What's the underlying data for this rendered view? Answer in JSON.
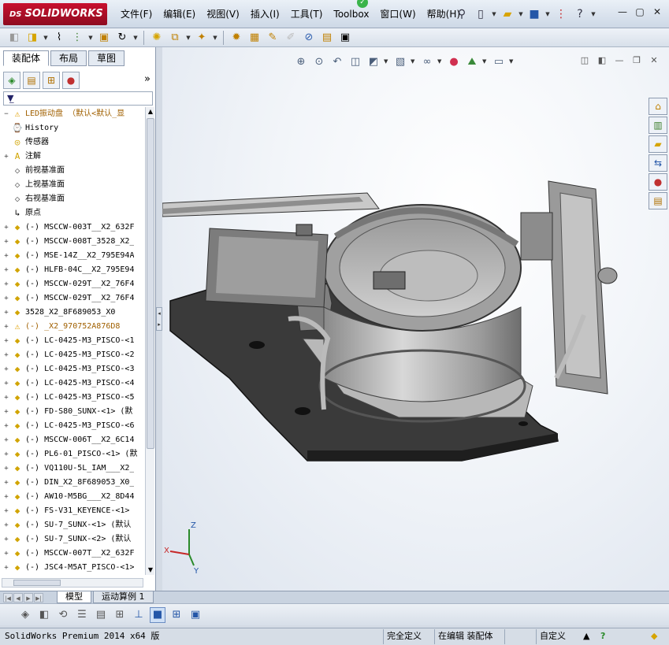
{
  "app": {
    "name": "SOLIDWORKS",
    "logo_prefix": "DS"
  },
  "menu": [
    "文件(F)",
    "编辑(E)",
    "视图(V)",
    "插入(I)",
    "工具(T)",
    "Toolbox",
    "窗口(W)",
    "帮助(H)"
  ],
  "title_tools": [
    "new-document-icon",
    "open-icon",
    "save-icon",
    "traffic-light-icon",
    "help-icon"
  ],
  "window_controls": {
    "minimize": "—",
    "restore": "▢",
    "close": "✕"
  },
  "toolbar_icons": [
    "assembly-icon",
    "insert-components-icon",
    "mate-icon",
    "smart-fastener-icon",
    "move-component-icon",
    "rotate-component-icon",
    "linear-pattern-icon",
    "smart-mates-icon",
    "explode-icon",
    "interference-icon",
    "hide-show-icon",
    "edit-component-icon",
    "assembly-features-icon",
    "reference-geometry-icon",
    "bill-of-materials-icon",
    "exploded-view-icon"
  ],
  "left_panel": {
    "tabs": [
      "装配体",
      "布局",
      "草图"
    ],
    "active_tab": 0,
    "icon_row": [
      "featuremanager-icon",
      "propertymanager-icon",
      "configurationmanager-icon",
      "appearance-icon"
    ],
    "more": "»",
    "filter_icon": "filter-icon"
  },
  "tree": [
    {
      "text": "LED振动盘 （默认<默认_显",
      "icon": "assembly-warning",
      "expand": "−",
      "color": "#a06000"
    },
    {
      "text": "History",
      "icon": "history",
      "expand": "",
      "color": "#000"
    },
    {
      "text": "传感器",
      "icon": "sensor",
      "expand": "",
      "color": "#000"
    },
    {
      "text": "注解",
      "icon": "annotation",
      "expand": "+",
      "color": "#000"
    },
    {
      "text": "前视基准面",
      "icon": "plane",
      "expand": "",
      "color": "#000"
    },
    {
      "text": "上视基准面",
      "icon": "plane",
      "expand": "",
      "color": "#000"
    },
    {
      "text": "右视基准面",
      "icon": "plane",
      "expand": "",
      "color": "#000"
    },
    {
      "text": "原点",
      "icon": "origin",
      "expand": "",
      "color": "#000"
    },
    {
      "text": "(-) MSCCW-003T__X2_632F",
      "icon": "part",
      "expand": "+",
      "color": "#000"
    },
    {
      "text": "(-) MSCCW-008T_3528_X2_",
      "icon": "part",
      "expand": "+",
      "color": "#000"
    },
    {
      "text": "(-) MSE-14Z__X2_795E94A",
      "icon": "part",
      "expand": "+",
      "color": "#000"
    },
    {
      "text": "(-) HLFB-04C__X2_795E94",
      "icon": "part",
      "expand": "+",
      "color": "#000"
    },
    {
      "text": "(-) MSCCW-029T__X2_76F4",
      "icon": "part",
      "expand": "+",
      "color": "#000"
    },
    {
      "text": "(-) MSCCW-029T__X2_76F4",
      "icon": "part",
      "expand": "+",
      "color": "#000"
    },
    {
      "text": "3528_X2_8F689053_X0",
      "icon": "part",
      "expand": "+",
      "color": "#000"
    },
    {
      "text": "(-) _X2_970752A876D8",
      "icon": "part-warning",
      "expand": "+",
      "color": "#a06000"
    },
    {
      "text": "(-) LC-0425-M3_PISCO-<1",
      "icon": "part",
      "expand": "+",
      "color": "#000"
    },
    {
      "text": "(-) LC-0425-M3_PISCO-<2",
      "icon": "part",
      "expand": "+",
      "color": "#000"
    },
    {
      "text": "(-) LC-0425-M3_PISCO-<3",
      "icon": "part",
      "expand": "+",
      "color": "#000"
    },
    {
      "text": "(-) LC-0425-M3_PISCO-<4",
      "icon": "part",
      "expand": "+",
      "color": "#000"
    },
    {
      "text": "(-) LC-0425-M3_PISCO-<5",
      "icon": "part",
      "expand": "+",
      "color": "#000"
    },
    {
      "text": "(-) FD-S80_SUNX-<1> (默",
      "icon": "part",
      "expand": "+",
      "color": "#000"
    },
    {
      "text": "(-) LC-0425-M3_PISCO-<6",
      "icon": "part",
      "expand": "+",
      "color": "#000"
    },
    {
      "text": "(-) MSCCW-006T__X2_6C14",
      "icon": "part",
      "expand": "+",
      "color": "#000"
    },
    {
      "text": "(-) PL6-01_PISCO-<1> (默",
      "icon": "part",
      "expand": "+",
      "color": "#000"
    },
    {
      "text": "(-) VQ110U-5L_IAM___X2_",
      "icon": "part",
      "expand": "+",
      "color": "#000"
    },
    {
      "text": "(-) DIN_X2_8F689053_X0_",
      "icon": "part",
      "expand": "+",
      "color": "#000"
    },
    {
      "text": "(-) AW10-M5BG___X2_8D44",
      "icon": "part",
      "expand": "+",
      "color": "#000"
    },
    {
      "text": "(-) FS-V31_KEYENCE-<1>",
      "icon": "part",
      "expand": "+",
      "color": "#000"
    },
    {
      "text": "(-) SU-7_SUNX-<1> (默认",
      "icon": "part",
      "expand": "+",
      "color": "#000"
    },
    {
      "text": "(-) SU-7_SUNX-<2> (默认",
      "icon": "part",
      "expand": "+",
      "color": "#000"
    },
    {
      "text": "(-) MSCCW-007T__X2_632F",
      "icon": "part",
      "expand": "+",
      "color": "#000"
    },
    {
      "text": "(-) JSC4-M5AT_PISCO-<1>",
      "icon": "part",
      "expand": "+",
      "color": "#000"
    }
  ],
  "viewport": {
    "heads_up_icons": [
      "zoom-to-fit-icon",
      "zoom-area-icon",
      "previous-view-icon",
      "section-view-icon",
      "view-orientation-icon",
      "display-style-icon",
      "hide-show-items-icon",
      "edit-appearance-icon",
      "apply-scene-icon",
      "view-settings-icon"
    ],
    "task_pane": [
      "home-icon",
      "design-library-icon",
      "file-explorer-icon",
      "view-palette-icon",
      "appearances-icon",
      "custom-properties-icon"
    ],
    "triad": {
      "x": "X",
      "y": "Y",
      "z": "Z"
    }
  },
  "bottom_tabs": [
    "模型",
    "运动算例 1"
  ],
  "bottom_active": 0,
  "view_toolbar": [
    "isometric-icon",
    "shaded-icon",
    "edges-icon",
    "lines-icon",
    "hatch-icon",
    "section-icon",
    "axis-icon",
    "cube-view-icon",
    "grid-view-icon",
    "palette-icon"
  ],
  "status": {
    "product": "SolidWorks Premium 2014 x64 版",
    "state": "完全定义",
    "editing": "在编辑 装配体",
    "custom": "自定义"
  }
}
